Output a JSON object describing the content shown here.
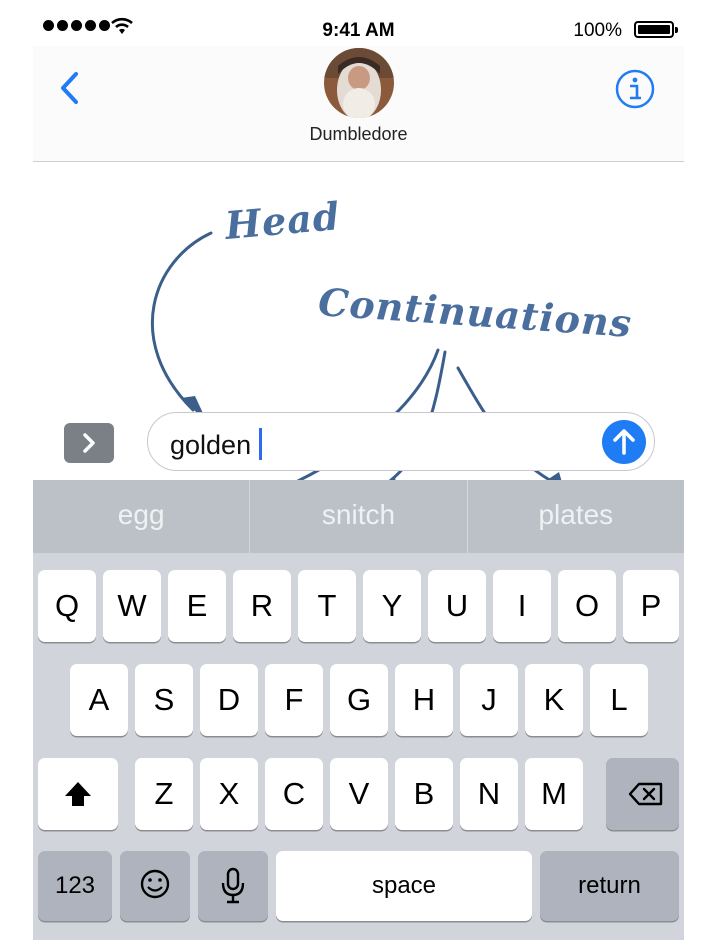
{
  "status_bar": {
    "signal_bars": 5,
    "time": "9:41 AM",
    "battery_percent": "100%"
  },
  "header": {
    "contact_name": "Dumbledore",
    "back_icon": "chevron-left-icon",
    "info_icon": "info-circle-icon"
  },
  "annotations": {
    "head": "Head",
    "continuations": "Continuations"
  },
  "composer": {
    "text": "golden",
    "apps_icon": "chevron-right-icon",
    "send_icon": "arrow-up-icon",
    "accent_color": "#1f7cf5"
  },
  "suggestions": [
    "egg",
    "snitch",
    "plates"
  ],
  "keyboard": {
    "row1": [
      "Q",
      "W",
      "E",
      "R",
      "T",
      "Y",
      "U",
      "I",
      "O",
      "P"
    ],
    "row2": [
      "A",
      "S",
      "D",
      "F",
      "G",
      "H",
      "J",
      "K",
      "L"
    ],
    "row3": [
      "Z",
      "X",
      "C",
      "V",
      "B",
      "N",
      "M"
    ],
    "numbers_label": "123",
    "space_label": "space",
    "return_label": "return",
    "shift_icon": "shift-icon",
    "delete_icon": "delete-icon",
    "emoji_icon": "emoji-icon",
    "mic_icon": "microphone-icon"
  }
}
